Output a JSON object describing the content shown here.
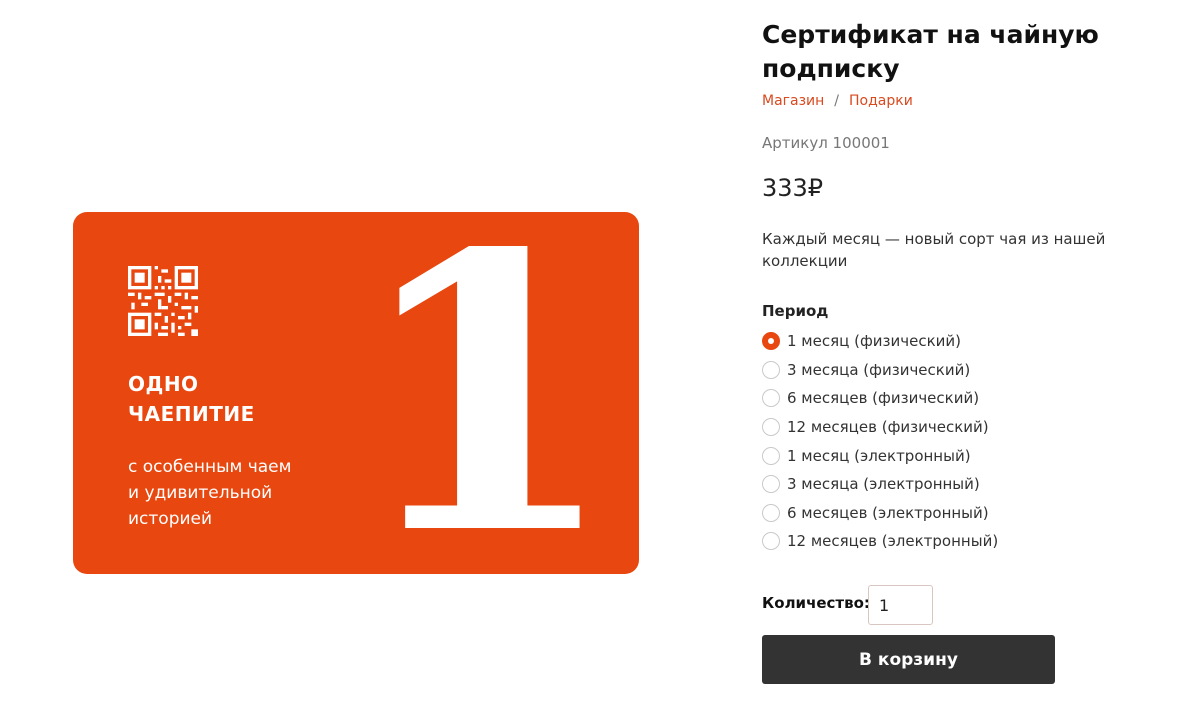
{
  "product": {
    "title": "Сертификат на чайную подписку",
    "breadcrumb": [
      "Магазин",
      "Подарки"
    ],
    "breadcrumb_separator": "/",
    "sku": "Артикул 100001",
    "price": "333₽",
    "description": "Каждый месяц — новый сорт чая из нашей коллекции"
  },
  "card": {
    "title_lines": [
      "ОДНО",
      "ЧАЕПИТИЕ"
    ],
    "subtitle_lines": [
      "с особенным чаем",
      "и удивительной",
      "историей"
    ],
    "big_number": "1",
    "background_color": "#e8470f"
  },
  "period": {
    "label": "Период",
    "selected_index": 0,
    "options": [
      "1 месяц (физический)",
      "3 месяца (физический)",
      "6 месяцев (физический)",
      "12 месяцев (физический)",
      "1 месяц (электронный)",
      "3 месяца (электронный)",
      "6 месяцев (электронный)",
      "12 месяцев (электронный)"
    ]
  },
  "quantity": {
    "label": "Количество:",
    "value": "1"
  },
  "cart": {
    "button_label": "В корзину"
  },
  "colors": {
    "accent": "#e8470f",
    "button": "#333333",
    "link": "#d94a1f"
  }
}
